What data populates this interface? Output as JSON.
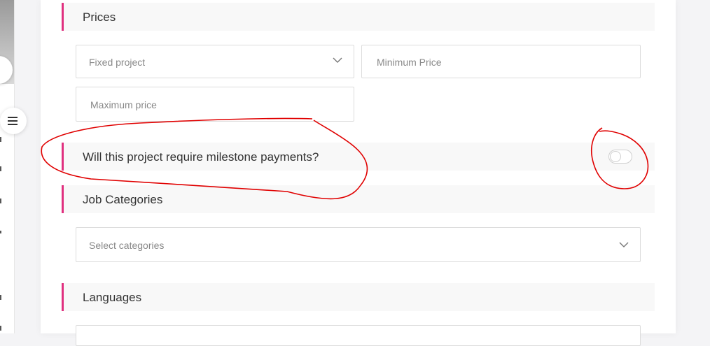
{
  "prices": {
    "heading": "Prices",
    "project_type_value": "Fixed project",
    "min_price_placeholder": "Minimum Price",
    "max_price_placeholder": "Maximum price"
  },
  "milestone": {
    "question": "Will this project require milestone payments?",
    "toggle_on": false
  },
  "job_categories": {
    "heading": "Job Categories",
    "select_placeholder": "Select categories"
  },
  "languages": {
    "heading": "Languages"
  },
  "colors": {
    "accent": "#e0307f",
    "annotation": "#e00000"
  }
}
